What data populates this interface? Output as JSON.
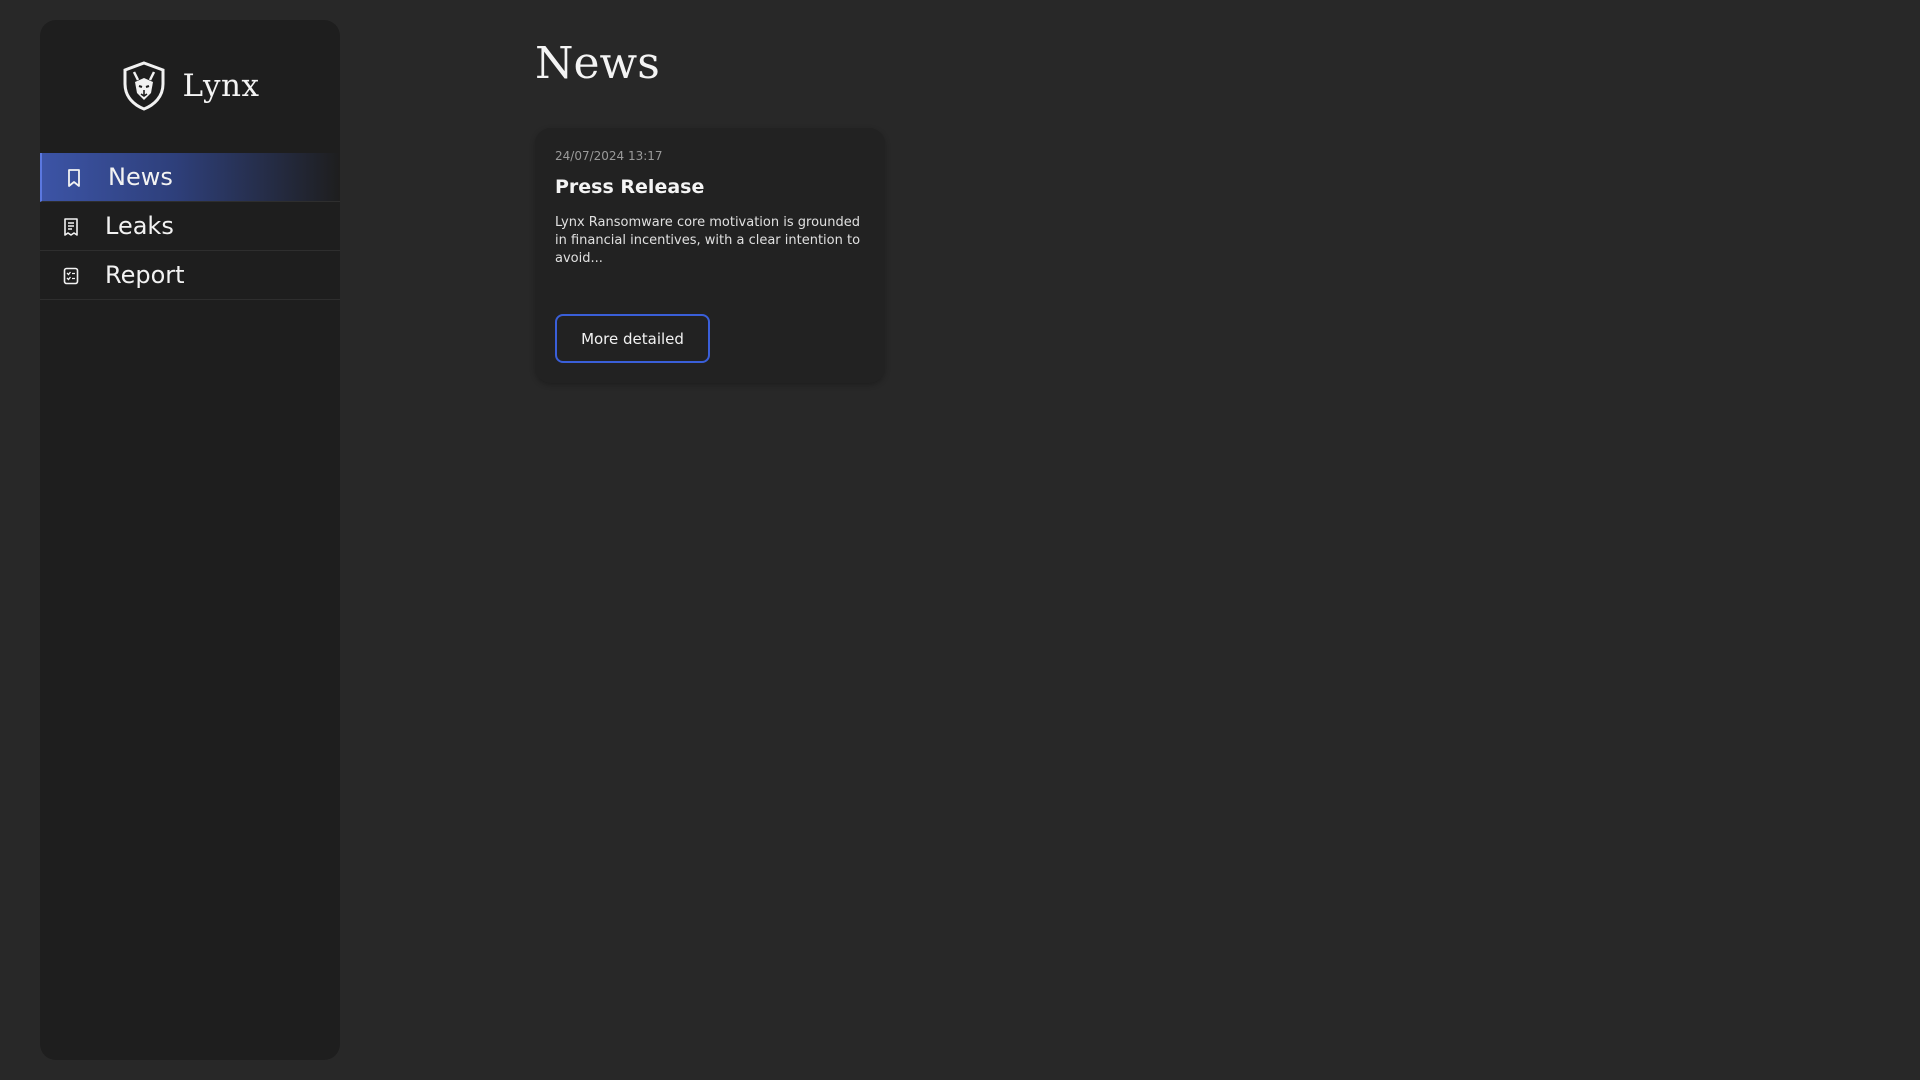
{
  "brand": {
    "name": "Lynx",
    "logo_icon": "lynx-shield-logo"
  },
  "sidebar": {
    "items": [
      {
        "label": "News",
        "icon": "bookmark-icon",
        "active": true
      },
      {
        "label": "Leaks",
        "icon": "receipt-icon",
        "active": false
      },
      {
        "label": "Report",
        "icon": "checklist-icon",
        "active": false
      }
    ]
  },
  "main": {
    "title": "News",
    "cards": [
      {
        "date": "24/07/2024 13:17",
        "title": "Press Release",
        "excerpt": "Lynx Ransomware core motivation is grounded in financial incentives, with a clear intention to avoid...",
        "button_label": "More detailed"
      }
    ]
  },
  "colors": {
    "background": "#282828",
    "sidebar": "#1e1e1e",
    "card": "#222222",
    "accent": "#3a5fd9",
    "active_gradient_start": "#3c54a6"
  }
}
